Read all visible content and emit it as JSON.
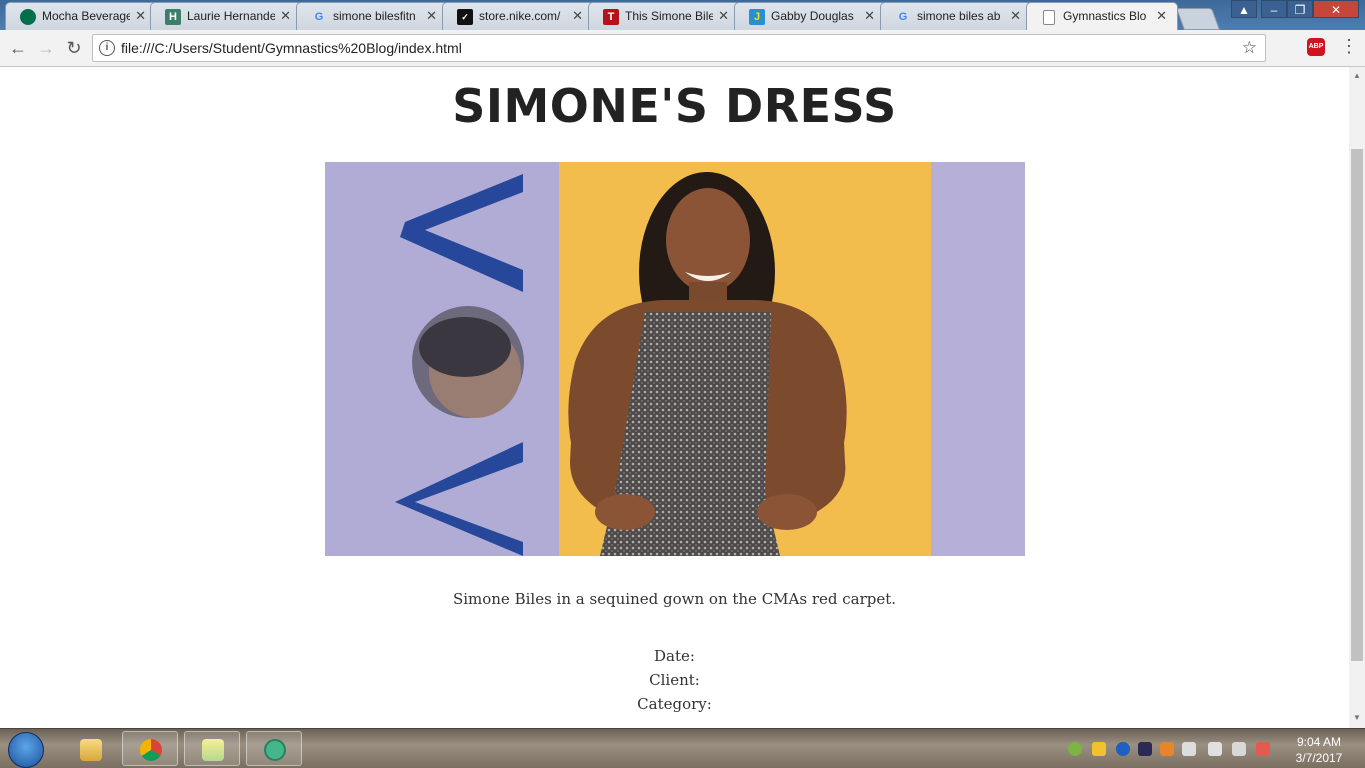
{
  "browser": {
    "tabs": [
      {
        "title": "Mocha Beverage",
        "favicon": "starbucks-icon",
        "color": "#00704a"
      },
      {
        "title": "Laurie Hernande",
        "favicon": "h-icon",
        "color": "#3b7f6a"
      },
      {
        "title": "simone bilesfitn",
        "favicon": "google-icon",
        "color": "#4285f4"
      },
      {
        "title": "store.nike.com/",
        "favicon": "nike-icon",
        "color": "#111111"
      },
      {
        "title": "This Simone Bile",
        "favicon": "t-icon",
        "color": "#b5121b"
      },
      {
        "title": "Gabby Douglas",
        "favicon": "j-icon",
        "color": "#2a8fd0"
      },
      {
        "title": "simone biles ab",
        "favicon": "google-icon",
        "color": "#4285f4"
      },
      {
        "title": "Gymnastics Blo",
        "favicon": "page-icon",
        "color": "#ffffff",
        "active": true
      }
    ],
    "url": "file:///C:/Users/Student/Gymnastics%20Blog/index.html",
    "abp_label": "ABP"
  },
  "page": {
    "heading": "SIMONE'S DRESS",
    "caption": "Simone Biles in a sequined gown on the CMAs red carpet.",
    "meta": {
      "date_label": "Date:",
      "client_label": "Client:",
      "category_label": "Category:"
    }
  },
  "taskbar": {
    "time": "9:04 AM",
    "date": "3/7/2017"
  },
  "colors": {
    "backdrop_lavender": "#b1acd6",
    "backdrop_yellow": "#f2bd4c",
    "letter_blue": "#26479a"
  }
}
